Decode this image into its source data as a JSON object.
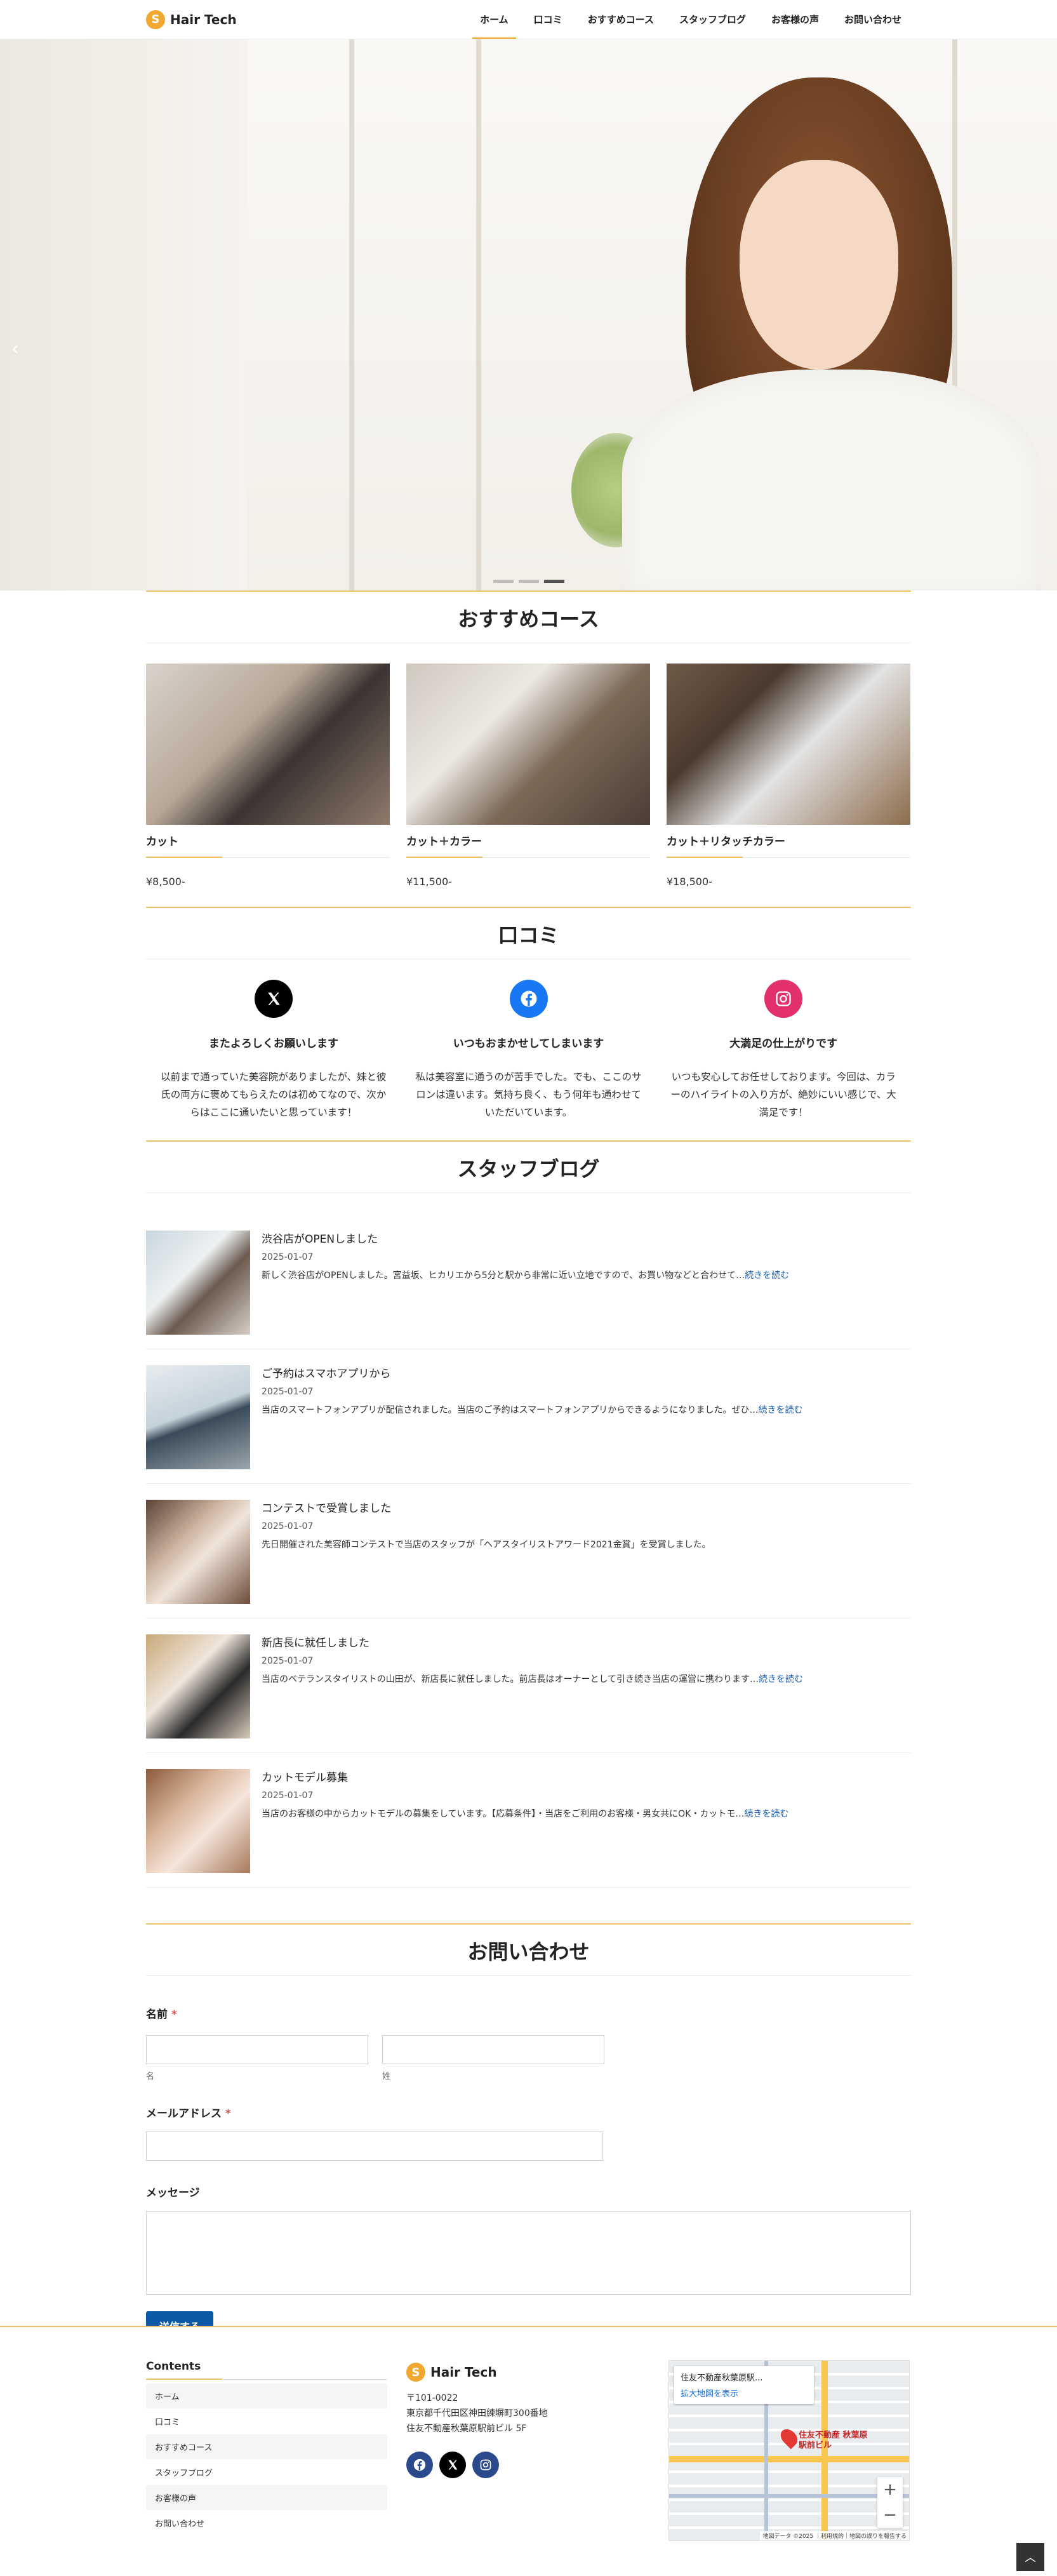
{
  "header": {
    "logo_mark": "S",
    "logo_text": "Hair Tech",
    "nav": [
      "ホーム",
      "口コミ",
      "おすすめコース",
      "スタッフブログ",
      "お客様の声",
      "お問い合わせ"
    ]
  },
  "hero": {
    "prev_arrow": "‹",
    "slide_count": 3,
    "active_slide": 3
  },
  "courses": {
    "heading": "おすすめコース",
    "items": [
      {
        "title": "カット",
        "price": "¥8,500-"
      },
      {
        "title": "カット＋カラー",
        "price": "¥11,500-"
      },
      {
        "title": "カット＋リタッチカラー",
        "price": "¥18,500-"
      }
    ]
  },
  "reviews": {
    "heading": "口コミ",
    "items": [
      {
        "icon": "x-icon",
        "title": "またよろしくお願いします",
        "text": "以前まで通っていた美容院がありましたが、妹と彼氏の両方に褒めてもらえたのは初めてなので、次からはここに通いたいと思っています！"
      },
      {
        "icon": "facebook-icon",
        "title": "いつもおまかせしてしまいます",
        "text": "私は美容室に通うのが苦手でした。でも、ここのサロンは違います。気持ち良く、もう何年も通わせていただいています。"
      },
      {
        "icon": "instagram-icon",
        "title": "大満足の仕上がりです",
        "text": "いつも安心してお任せしております。今回は、カラーのハイライトの入り方が、絶妙にいい感じで、大満足です！"
      }
    ]
  },
  "blog": {
    "heading": "スタッフブログ",
    "items": [
      {
        "title": "渋谷店がOPENしました",
        "date": "2025-01-07",
        "excerpt": "新しく渋谷店がOPENしました。宮益坂、ヒカリエから5分と駅から非常に近い立地ですので、お買い物などと合わせて…",
        "more": "続きを読む"
      },
      {
        "title": "ご予約はスマホアプリから",
        "date": "2025-01-07",
        "excerpt": "当店のスマートフォンアプリが配信されました。当店のご予約はスマートフォンアプリからできるようになりました。ぜひ…",
        "more": "続きを読む"
      },
      {
        "title": "コンテストで受賞しました",
        "date": "2025-01-07",
        "excerpt": "先日開催された美容師コンテストで当店のスタッフが「ヘアスタイリストアワード2021金賞」を受賞しました。",
        "more": ""
      },
      {
        "title": "新店長に就任しました",
        "date": "2025-01-07",
        "excerpt": "当店のベテランスタイリストの山田が、新店長に就任しました。前店長はオーナーとして引き続き当店の運営に携わります…",
        "more": "続きを読む"
      },
      {
        "title": "カットモデル募集",
        "date": "2025-01-07",
        "excerpt": "当店のお客様の中からカットモデルの募集をしています。【応募条件】・当店をご利用のお客様・男女共にOK・カットモ…",
        "more": "続きを読む"
      }
    ]
  },
  "contact": {
    "heading": "お問い合わせ",
    "name_label": "名前",
    "required_mark": "*",
    "last_name_sub": "名",
    "first_name_sub": "姓",
    "email_label": "メールアドレス",
    "message_label": "メッセージ",
    "submit": "送信する"
  },
  "footer": {
    "contents_title": "Contents",
    "links": [
      "ホーム",
      "口コミ",
      "おすすめコース",
      "スタッフブログ",
      "お客様の声",
      "お問い合わせ"
    ],
    "logo_mark": "S",
    "logo_text": "Hair Tech",
    "postal": "〒101-0022",
    "address1": "東京都千代田区神田練塀町300番地",
    "address2": "住友不動産秋葉原駅前ビル 5F",
    "map": {
      "card_title": "住友不動産秋葉原駅...",
      "card_link": "拡大地図を表示",
      "pin_label": "住友不動産 秋葉原駅前ビル",
      "zoom_in": "+",
      "zoom_out": "−",
      "attribution": "地図データ ©2025 ｜利用規約｜地図の誤りを報告する"
    },
    "to_top": "︿"
  },
  "colors": {
    "accent": "#f0c06a",
    "button": "#0c5aa6",
    "link": "#1a5fb4"
  }
}
